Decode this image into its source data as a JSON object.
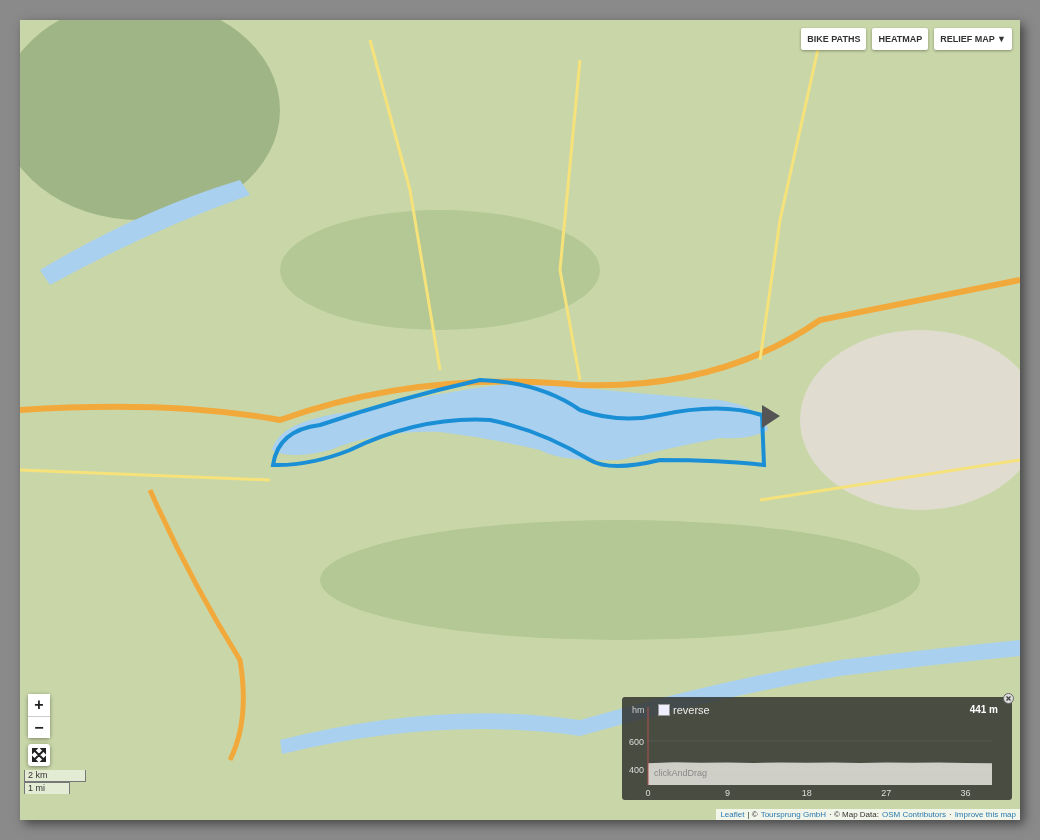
{
  "layer_buttons": [
    {
      "label": "BIKE PATHS"
    },
    {
      "label": "HEATMAP"
    },
    {
      "label": "RELIEF MAP ▼"
    }
  ],
  "zoom_controls": {
    "zoom_in": "+",
    "zoom_out": "−"
  },
  "scale": {
    "metric": "2 km",
    "imperial": "1 mi"
  },
  "elevation_panel": {
    "unit_label": "hm",
    "reverse": {
      "label": "reverse",
      "checked": false
    },
    "current_elevation": "441 m",
    "hint": "clickAndDrag",
    "chart_data": {
      "type": "area",
      "x": [
        0,
        3,
        6,
        9,
        12,
        15,
        18,
        21,
        24,
        27,
        30,
        33,
        36,
        39
      ],
      "series": [
        {
          "color": "#e6e6e0",
          "values": [
            442,
            448,
            445,
            446,
            444,
            447,
            445,
            446,
            444,
            447,
            445,
            446,
            444,
            441
          ]
        }
      ],
      "xlim": [
        0,
        39
      ],
      "ylim": [
        286,
        843
      ],
      "xticks": [
        0,
        9,
        18,
        27,
        36
      ],
      "yticks": [
        400,
        600
      ]
    }
  },
  "attribution": [
    {
      "text": "Leaflet",
      "kind": "link"
    },
    {
      "text": "| ©",
      "kind": "plain"
    },
    {
      "text": "Toursprung GmbH",
      "kind": "link"
    },
    {
      "text": "· © Map Data:",
      "kind": "plain"
    },
    {
      "text": "OSM Contributors",
      "kind": "link"
    },
    {
      "text": "·",
      "kind": "plain"
    },
    {
      "text": "Improve this map",
      "kind": "link"
    }
  ]
}
